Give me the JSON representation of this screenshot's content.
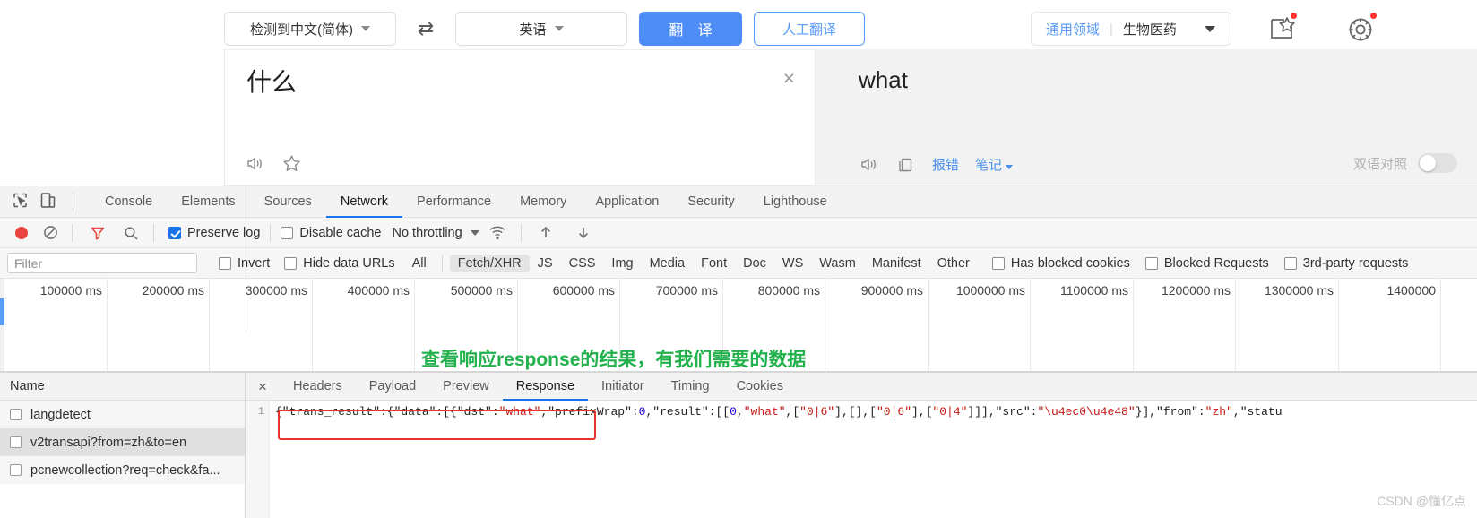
{
  "translator": {
    "source_lang": "检测到中文(简体)",
    "target_lang": "英语",
    "swap_icon": "swap-icon",
    "translate_button": "翻 译",
    "human_translate_button": "人工翻译",
    "domain_general": "通用领域",
    "domain_separator": "|",
    "domain_current": "生物医药",
    "collect_icon": "collect-icon",
    "settings_icon": "gear-icon",
    "source_text": "什么",
    "target_text": "what",
    "clear_icon": "×",
    "source_tools": {
      "speaker": "speaker-icon",
      "favorite": "star-icon"
    },
    "target_tools": {
      "speaker": "speaker-icon",
      "copy": "copy-icon",
      "report": "报错",
      "notes": "笔记"
    },
    "bilingual_label": "双语对照",
    "bilingual_on": false
  },
  "devtools": {
    "panel_tabs": [
      "Console",
      "Elements",
      "Sources",
      "Network",
      "Performance",
      "Memory",
      "Application",
      "Security",
      "Lighthouse"
    ],
    "active_panel": "Network",
    "inspect_icon": "inspect-cursor-icon",
    "device_icon": "device-toolbar-icon",
    "toolbar": {
      "record_icon": "record-icon",
      "clear_icon": "clear-icon",
      "filter_icon": "filter-icon",
      "search_icon": "search-icon",
      "preserve_log": "Preserve log",
      "preserve_log_checked": true,
      "disable_cache": "Disable cache",
      "disable_cache_checked": false,
      "throttling": "No throttling",
      "wifi_icon": "network-conditions-icon",
      "import_icon": "import-har-icon",
      "export_icon": "export-har-icon"
    },
    "filterbar": {
      "filter_placeholder": "Filter",
      "invert": "Invert",
      "invert_checked": false,
      "hide_data_urls": "Hide data URLs",
      "hide_data_urls_checked": false,
      "types": [
        "All",
        "Fetch/XHR",
        "JS",
        "CSS",
        "Img",
        "Media",
        "Font",
        "Doc",
        "WS",
        "Wasm",
        "Manifest",
        "Other"
      ],
      "selected_type": "Fetch/XHR",
      "has_blocked_cookies": "Has blocked cookies",
      "has_blocked_cookies_checked": false,
      "blocked_requests": "Blocked Requests",
      "blocked_requests_checked": false,
      "third_party": "3rd-party requests",
      "third_party_checked": false
    },
    "timeline": {
      "ticks": [
        "100000 ms",
        "200000 ms",
        "300000 ms",
        "400000 ms",
        "500000 ms",
        "600000 ms",
        "700000 ms",
        "800000 ms",
        "900000 ms",
        "1000000 ms",
        "1100000 ms",
        "1200000 ms",
        "1300000 ms",
        "1400000"
      ],
      "annotation": "查看响应response的结果，有我们需要的数据"
    },
    "requests": {
      "column_header": "Name",
      "rows": [
        {
          "name": "langdetect",
          "selected": false
        },
        {
          "name": "v2transapi?from=zh&to=en",
          "selected": true
        },
        {
          "name": "pcnewcollection?req=check&fa...",
          "selected": false
        }
      ]
    },
    "detail": {
      "close_icon": "×",
      "tabs": [
        "Headers",
        "Payload",
        "Preview",
        "Response",
        "Initiator",
        "Timing",
        "Cookies"
      ],
      "active_tab": "Response",
      "line_number": "1",
      "response_json": "{\"trans_result\":{\"data\":[{\"dst\":\"what\",\"prefixWrap\":0,\"result\":[[0,\"what\",[\"0|6\"],[],[\"0|6\"],[\"0|4\"]]],\"src\":\"\\u4ec0\\u4e48\"}],\"from\":\"zh\",\"statu",
      "tokens": [
        {
          "t": "{\"trans_result\":{\"data\":[{\"dst\":",
          "c": "plain"
        },
        {
          "t": "\"what\"",
          "c": "str"
        },
        {
          "t": ",\"prefixWrap\":",
          "c": "plain"
        },
        {
          "t": "0",
          "c": "num"
        },
        {
          "t": ",\"result\":[[",
          "c": "plain"
        },
        {
          "t": "0",
          "c": "num"
        },
        {
          "t": ",",
          "c": "plain"
        },
        {
          "t": "\"what\"",
          "c": "str"
        },
        {
          "t": ",[",
          "c": "plain"
        },
        {
          "t": "\"0|6\"",
          "c": "str"
        },
        {
          "t": "],[],[",
          "c": "plain"
        },
        {
          "t": "\"0|6\"",
          "c": "str"
        },
        {
          "t": "],[",
          "c": "plain"
        },
        {
          "t": "\"0|4\"",
          "c": "str"
        },
        {
          "t": "]]],\"src\":",
          "c": "plain"
        },
        {
          "t": "\"\\u4ec0\\u4e48\"",
          "c": "str"
        },
        {
          "t": "}],\"from\":",
          "c": "plain"
        },
        {
          "t": "\"zh\"",
          "c": "str"
        },
        {
          "t": ",\"statu",
          "c": "plain"
        }
      ]
    }
  },
  "watermark": "CSDN @懂亿点",
  "colors": {
    "accent_blue": "#4e8cf7",
    "devtools_tab_active": "#1a73e8",
    "annotation_green": "#22b14c",
    "highlight_red": "#e8342a",
    "record_red": "#e8453c"
  }
}
